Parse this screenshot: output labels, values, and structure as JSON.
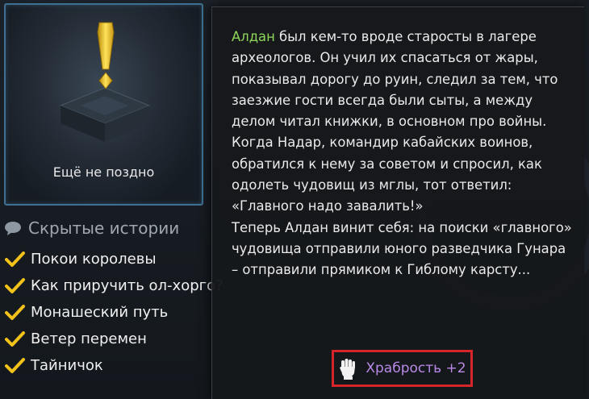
{
  "quest": {
    "title": "Ещё не поздно",
    "icon": "exclamation-quest-icon"
  },
  "hidden_stories": {
    "title": "Скрытые истории",
    "items": [
      {
        "label": "Покои королевы",
        "done": true
      },
      {
        "label": "Как приручить ол-хорго?",
        "done": true
      },
      {
        "label": "Монашеский путь",
        "done": true
      },
      {
        "label": "Ветер перемен",
        "done": true
      },
      {
        "label": "Тайничок",
        "done": true
      }
    ]
  },
  "tooltip": {
    "npc_name": "Алдан",
    "paragraph_1": " был кем-то вроде старосты в лагере археологов. Он учил их спасаться от жары, показывал дорогу до руин, следил за тем, что заезжие гости всегда были сыты, а между делом читал книжки, в основном про войны. Когда Надар, командир кабайских воинов, обратился к нему за советом и спросил, как одолеть чудовищ из мглы, тот ответил: «Главного надо завалить!»",
    "paragraph_2": "Теперь Алдан винит себя: на поиски «главного» чудовища отправили юного разведчика Гунара – отправили прямиком к Гиблому карсту...",
    "reward": {
      "icon": "fist-icon",
      "label": "Храбрость +2"
    }
  },
  "colors": {
    "npc": "#8ed65a",
    "reward": "#b889e6",
    "highlight_border": "#d5252b",
    "check": "#f2c21a",
    "card_border": "#3f6f93"
  }
}
